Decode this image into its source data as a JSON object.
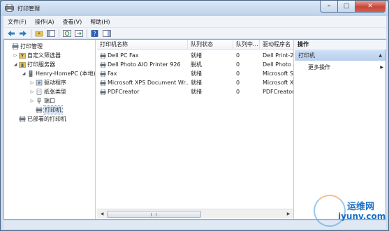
{
  "window": {
    "title": "打印管理",
    "min": "–",
    "max": "□",
    "close": "✕"
  },
  "menu": [
    "文件(F)",
    "操作(A)",
    "查看(V)",
    "帮助(H)"
  ],
  "tree": {
    "root": "打印管理",
    "custom_filters": "自定义筛选器",
    "print_servers": "打印服务器",
    "server": "Henry-HomePC (本地)",
    "drivers": "驱动程序",
    "forms": "纸张类型",
    "ports": "端口",
    "printers": "打印机",
    "deployed": "已部署的打印机"
  },
  "list": {
    "columns": [
      "打印机名称",
      "队列状态",
      "队列中...",
      "驱动程序名"
    ],
    "rows": [
      {
        "name": "Dell PC Fax",
        "status": "就绪",
        "jobs": "0",
        "driver": "Dell Print-2-"
      },
      {
        "name": "Dell Photo AIO Printer 926",
        "status": "脱机",
        "jobs": "0",
        "driver": "Dell Photo A"
      },
      {
        "name": "Fax",
        "status": "就绪",
        "jobs": "0",
        "driver": "Microsoft S"
      },
      {
        "name": "Microsoft XPS Document Wr...",
        "status": "就绪",
        "jobs": "0",
        "driver": "Microsoft X"
      },
      {
        "name": "PDFCreator",
        "status": "就绪",
        "jobs": "0",
        "driver": "PDFCreator"
      }
    ],
    "scroll_left": "◀",
    "scroll_right": "▶"
  },
  "actions": {
    "title": "操作",
    "section": "打印机",
    "more": "更多操作",
    "section_caret": "▲",
    "more_arrow": "▶"
  },
  "watermark": {
    "cn": "运维网",
    "en": "iyunv.com"
  }
}
